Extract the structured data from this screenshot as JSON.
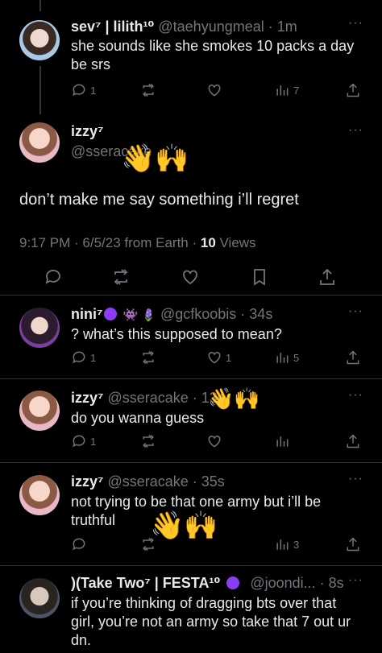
{
  "tweets": [
    {
      "name": "sev⁷ | lilith¹⁰",
      "handle": "@taehyungmeal · 1m",
      "text_line1": "she sounds like she smokes 10 packs a day",
      "text_line2": "be srs",
      "reply_count": "1",
      "views": "7"
    },
    {
      "name": "izzy⁷",
      "handle": "@sseracake",
      "text": "don’t make me say something i’ll regret",
      "meta_time": "9:17 PM · 6/5/23 from Earth · ",
      "meta_views_num": "10",
      "meta_views_label": " Views"
    },
    {
      "name": "nini⁷",
      "name_extra": "👾 🪻",
      "handle": "@gcfkoobis · 34s",
      "text": "? what’s this supposed to mean?",
      "reply_count": "1",
      "like_count": "1",
      "views": "5"
    },
    {
      "name": "izzy⁷",
      "handle": "@sseracake · 13s",
      "text": "do you wanna guess",
      "reply_count": "1"
    },
    {
      "name": "izzy⁷",
      "handle": "@sseracake · 35s",
      "text_line1": "not trying to be that one army but i’ll be",
      "text_line2": "truthful",
      "views": "3"
    },
    {
      "name": ")(Take Two⁷ | FESTA¹⁰",
      "handle": "@joondi... · 8s",
      "text_line1": "if you’re thinking of dragging bts over that",
      "text_line2": "girl, you’re not an army so take that 7 out ur",
      "text_line3": "dn."
    }
  ],
  "colors": {
    "background": "#000000",
    "text": "#e7e9ea",
    "muted": "#71767b",
    "divider": "#2f3336",
    "accent": "#8b3df5"
  }
}
